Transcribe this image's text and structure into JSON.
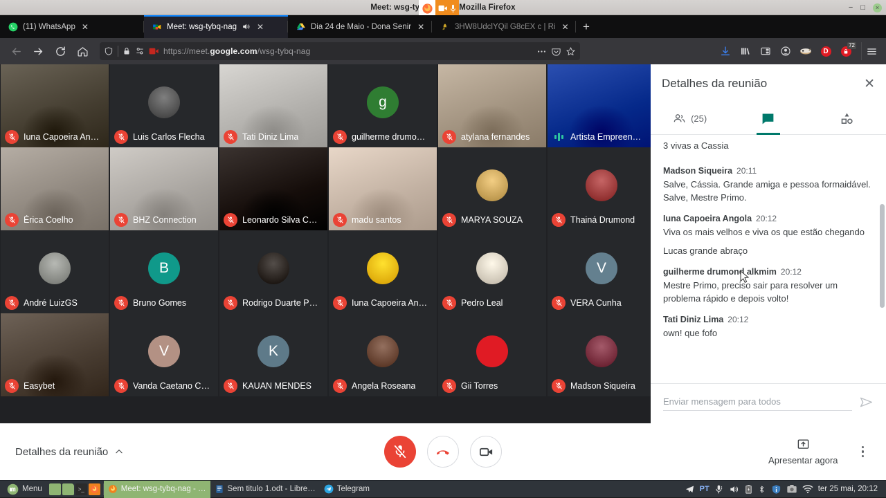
{
  "window": {
    "title": "Meet: wsg-tybq-nag — Mozilla Firefox",
    "title_left": "Meet: wsg-t",
    "title_right": "ozilla Firefox",
    "minimize": "−",
    "maximize": "□",
    "close": "×"
  },
  "tabs": [
    {
      "label": "(11) WhatsApp",
      "icon": "whatsapp-icon",
      "active": false,
      "muted": false
    },
    {
      "label": "Meet: wsg-tybq-nag",
      "icon": "google-meet-icon",
      "active": true,
      "muted": true
    },
    {
      "label": "Dia 24 de Maio - Dona Senir",
      "icon": "google-drive-icon",
      "active": false,
      "muted": false
    },
    {
      "label": "3HW8UdclYQil G8cEX c | Ri",
      "icon": "generic-page-icon",
      "active": false,
      "muted": false
    }
  ],
  "newtab_label": "+",
  "nav": {
    "back": "←",
    "forward": "→",
    "reload": "⟳",
    "home": "⌂",
    "url_scheme": "https://",
    "url_domain_pre": "meet.",
    "url_domain_bold": "google.com",
    "url_path": "/wsg-tybq-nag",
    "url_full": "https://meet.google.com/wsg-tybq-nag",
    "shield_icon": "shield-icon",
    "lock_icon": "lock-icon",
    "permissions_icon": "site-permissions-icon",
    "camera_icon": "camera-active-icon",
    "more_icon": "page-actions-icon",
    "pocket_icon": "pocket-icon",
    "bookmark_icon": "bookmark-star-icon"
  },
  "toolbar_icons": [
    {
      "name": "downloads-icon",
      "badge": ""
    },
    {
      "name": "library-icon",
      "badge": ""
    },
    {
      "name": "sidebar-icon",
      "badge": ""
    },
    {
      "name": "account-icon",
      "badge": ""
    },
    {
      "name": "extension-icon",
      "badge": ""
    },
    {
      "name": "dashlane-icon",
      "badge": "",
      "letter": "D"
    },
    {
      "name": "lastpass-icon",
      "badge": "72",
      "letter": "🔒"
    },
    {
      "name": "menu-icon",
      "badge": ""
    }
  ],
  "meet": {
    "participants": [
      {
        "name": "Iuna Capoeira An…",
        "kind": "video",
        "bg": "#6a6356",
        "muted": true,
        "speaking": false
      },
      {
        "name": "Luis Carlos Flecha",
        "kind": "avatar-photo",
        "bg": "#26282b",
        "avatar": "#555",
        "muted": true,
        "speaking": false
      },
      {
        "name": "Tati Diniz Lima",
        "kind": "video",
        "bg": "#d8d6d2",
        "muted": true,
        "speaking": false
      },
      {
        "name": "guilherme drumo…",
        "kind": "avatar-letter",
        "letter": "g",
        "avatar": "#2f7d32",
        "bg": "#26282b",
        "muted": true,
        "speaking": false
      },
      {
        "name": "atylana fernandes",
        "kind": "video",
        "bg": "#c6b7a4",
        "muted": true,
        "speaking": false
      },
      {
        "name": "Artista Empreen…",
        "kind": "video",
        "bg": "#2b4fb0",
        "muted": false,
        "speaking": true
      },
      {
        "name": "Érica Coelho",
        "kind": "video",
        "bg": "#b5ada4",
        "muted": true,
        "speaking": false
      },
      {
        "name": "BHZ Connection",
        "kind": "video",
        "bg": "#cfcbc6",
        "muted": true,
        "speaking": false
      },
      {
        "name": "Leonardo Silva C…",
        "kind": "video",
        "bg": "#3b3330",
        "muted": true,
        "speaking": false
      },
      {
        "name": "madu santos",
        "kind": "video",
        "bg": "#e8d7c8",
        "muted": true,
        "speaking": false
      },
      {
        "name": "MARYA SOUZA",
        "kind": "avatar-photo",
        "bg": "#26282b",
        "avatar": "#c9a45a",
        "muted": true,
        "speaking": false
      },
      {
        "name": "Thainá Drumond",
        "kind": "avatar-photo",
        "bg": "#26282b",
        "avatar": "#9c3b3b",
        "muted": true,
        "speaking": false
      },
      {
        "name": "André LuizGS",
        "kind": "avatar-photo",
        "bg": "#26282b",
        "avatar": "#8d8f8a",
        "muted": true,
        "speaking": false
      },
      {
        "name": "Bruno Gomes",
        "kind": "avatar-letter",
        "letter": "B",
        "avatar": "#10998a",
        "bg": "#26282b",
        "muted": true,
        "speaking": false
      },
      {
        "name": "Rodrigo Duarte P…",
        "kind": "avatar-photo",
        "bg": "#26282b",
        "avatar": "#2a2420",
        "muted": true,
        "speaking": false
      },
      {
        "name": "Iuna Capoeira An…",
        "kind": "avatar-photo",
        "bg": "#26282b",
        "avatar": "#f2b705",
        "muted": true,
        "speaking": false
      },
      {
        "name": "Pedro Leal",
        "kind": "avatar-photo",
        "bg": "#26282b",
        "avatar": "#d8cfc0",
        "muted": true,
        "speaking": false
      },
      {
        "name": "VERA Cunha",
        "kind": "avatar-letter",
        "letter": "V",
        "avatar": "#64808f",
        "bg": "#26282b",
        "muted": true,
        "speaking": false
      },
      {
        "name": "Easybet",
        "kind": "video",
        "bg": "#6e6257",
        "muted": true,
        "speaking": false
      },
      {
        "name": "Vanda Caetano C…",
        "kind": "avatar-letter",
        "letter": "V",
        "avatar": "#b39184",
        "bg": "#26282b",
        "muted": true,
        "speaking": false
      },
      {
        "name": "KAUAN MENDES",
        "kind": "avatar-letter",
        "letter": "K",
        "avatar": "#5e7a89",
        "bg": "#26282b",
        "muted": true,
        "speaking": false
      },
      {
        "name": "Angela Roseana",
        "kind": "avatar-photo",
        "bg": "#26282b",
        "avatar": "#6a4635",
        "muted": true,
        "speaking": false
      },
      {
        "name": "Gii Torres",
        "kind": "avatar-letter",
        "letter": "",
        "avatar": "#e01b24",
        "bg": "#26282b",
        "muted": true,
        "speaking": false
      },
      {
        "name": "Madson Siqueira",
        "kind": "avatar-photo",
        "bg": "#26282b",
        "avatar": "#7a3040",
        "muted": true,
        "speaking": false
      }
    ],
    "bottom": {
      "details_label": "Detalhes da reunião",
      "details_chevron": "⌃",
      "mic_icon": "mic-off-icon",
      "hangup_icon": "hangup-icon",
      "camera_icon": "camera-icon",
      "present_label": "Apresentar agora",
      "present_icon": "present-screen-icon",
      "more_icon": "more-options-icon"
    }
  },
  "chat": {
    "title": "Detalhes da reunião",
    "close_icon": "close-icon",
    "tabs": [
      {
        "name": "people-tab",
        "icon": "people-icon",
        "label": "(25)",
        "active": false
      },
      {
        "name": "chat-tab",
        "icon": "chat-bubble-icon",
        "label": "",
        "active": true
      },
      {
        "name": "activities-tab",
        "icon": "activities-shapes-icon",
        "label": "",
        "active": false
      }
    ],
    "partial_message": "3 vivas a Cassia",
    "messages": [
      {
        "author": "Madson Siqueira",
        "time": "20:11",
        "lines": [
          "Salve, Cássia. Grande amiga e pessoa formaidável. Salve, Mestre Primo."
        ]
      },
      {
        "author": "Iuna Capoeira Angola",
        "time": "20:12",
        "lines": [
          "Viva os mais velhos e viva os que estão chegando",
          "Lucas grande abraço"
        ]
      },
      {
        "author": "guilherme drumond alkmim",
        "time": "20:12",
        "lines": [
          "Mestre Primo, preciso sair para resolver um problema rápido e depois volto!"
        ]
      },
      {
        "author": "Tati Diniz Lima",
        "time": "20:12",
        "lines": [
          "own! que fofo"
        ]
      }
    ],
    "composer_placeholder": "Enviar mensagem para todos",
    "send_icon": "send-icon"
  },
  "taskbar": {
    "menu_label": "Menu",
    "launchers": [
      {
        "name": "show-desktop-launcher"
      },
      {
        "name": "files-launcher"
      },
      {
        "name": "terminal-launcher"
      },
      {
        "name": "firefox-launcher"
      }
    ],
    "windows": [
      {
        "label": "Meet: wsg-tybq-nag - …",
        "icon": "firefox-icon",
        "active": true
      },
      {
        "label": "Sem titulo 1.odt - Libre…",
        "icon": "libreoffice-writer-icon",
        "active": false
      },
      {
        "label": "Telegram",
        "icon": "telegram-icon",
        "active": false
      }
    ],
    "tray": [
      {
        "name": "telegram-tray-icon"
      },
      {
        "name": "keyboard-layout-indicator",
        "label": "PT"
      },
      {
        "name": "microphone-tray-icon"
      },
      {
        "name": "volume-tray-icon"
      },
      {
        "name": "battery-tray-icon"
      },
      {
        "name": "bluetooth-tray-icon"
      },
      {
        "name": "update-manager-tray-icon"
      },
      {
        "name": "screenshot-tray-icon"
      },
      {
        "name": "network-wifi-tray-icon"
      }
    ],
    "clock": "ter 25 mai, 20:12"
  },
  "colors": {
    "accent_teal": "#00796b",
    "red": "#ea4335",
    "speaking": "#2ec5a0",
    "firefox_orange": "#f08c1e",
    "mint_green": "#8fb573"
  }
}
